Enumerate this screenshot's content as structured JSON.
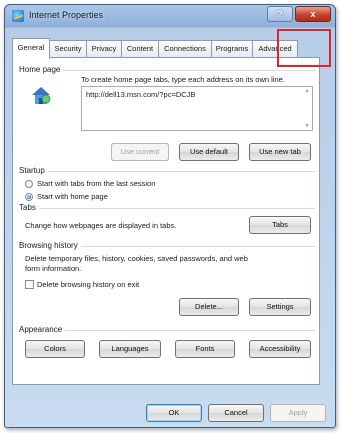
{
  "window": {
    "title": "Internet Properties",
    "help_symbol": "?",
    "close_symbol": "x"
  },
  "tabs": [
    "General",
    "Security",
    "Privacy",
    "Content",
    "Connections",
    "Programs",
    "Advanced"
  ],
  "home_page": {
    "heading": "Home page",
    "instruction": "To create home page tabs, type each address on its own line.",
    "address": "http://dell13.msn.com/?pc=DCJB",
    "buttons": {
      "use_current": "Use current",
      "use_default": "Use default",
      "use_new_tab": "Use new tab"
    }
  },
  "startup": {
    "heading": "Startup",
    "options": [
      "Start with tabs from the last session",
      "Start with home page"
    ],
    "selected_index": 1
  },
  "tabs_section": {
    "heading": "Tabs",
    "description": "Change how webpages are displayed in tabs.",
    "button": "Tabs"
  },
  "browsing_history": {
    "heading": "Browsing history",
    "description_line1": "Delete temporary files, history, cookies, saved passwords, and web",
    "description_line2": "form information.",
    "checkbox_label": "Delete browsing history on exit",
    "checkbox_checked": false,
    "delete_button": "Delete...",
    "settings_button": "Settings"
  },
  "appearance": {
    "heading": "Appearance",
    "buttons": [
      "Colors",
      "Languages",
      "Fonts",
      "Accessibility"
    ]
  },
  "footer": {
    "ok": "OK",
    "cancel": "Cancel",
    "apply": "Apply"
  },
  "colors": {
    "highlight_border": "#e0252a",
    "title_bar": "#8fb0d8",
    "close_button": "#c6432d"
  },
  "icons": {
    "title_icon": "internet-explorer-icon",
    "home_icon": "home-page-icon"
  }
}
